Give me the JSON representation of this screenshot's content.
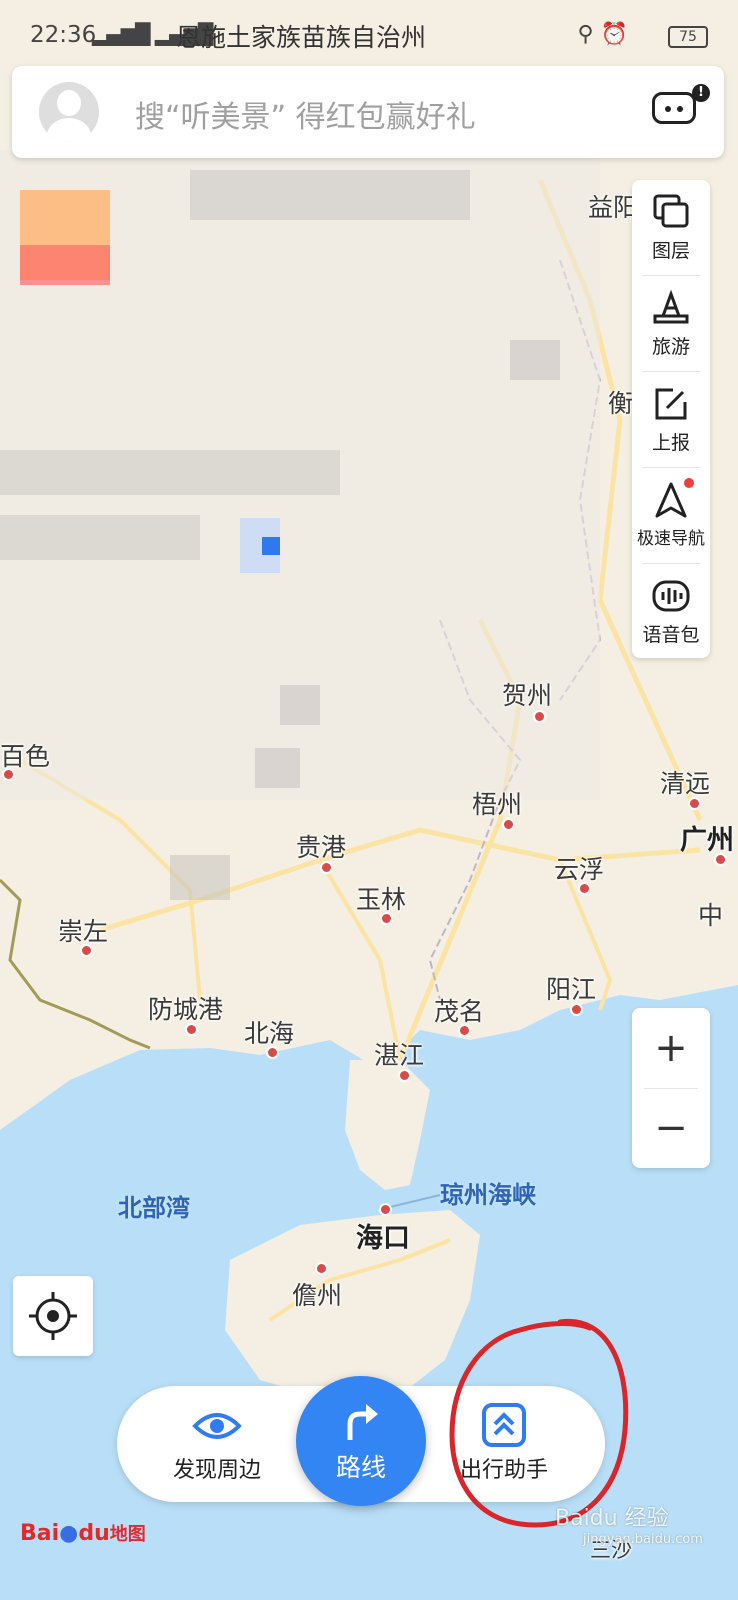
{
  "status_bar": {
    "time": "22:36",
    "signal": "4G 4G",
    "region": "恩施土家族苗族自治州",
    "battery": "75"
  },
  "search": {
    "placeholder": "搜“听美景” 得红包赢好礼"
  },
  "toolbar": {
    "items": [
      {
        "label": "图层",
        "icon": "layers-icon"
      },
      {
        "label": "旅游",
        "icon": "travel-icon"
      },
      {
        "label": "上报",
        "icon": "report-icon"
      },
      {
        "label": "极速导航",
        "icon": "navigation-icon",
        "badge": true
      },
      {
        "label": "语音包",
        "icon": "voice-pack-icon"
      }
    ]
  },
  "map": {
    "places": [
      {
        "name": "益阳"
      },
      {
        "name": "衡"
      },
      {
        "name": "贺州"
      },
      {
        "name": "梧州"
      },
      {
        "name": "清远"
      },
      {
        "name": "广州"
      },
      {
        "name": "百色"
      },
      {
        "name": "贵港"
      },
      {
        "name": "云浮"
      },
      {
        "name": "崇左"
      },
      {
        "name": "玉林"
      },
      {
        "name": "中"
      },
      {
        "name": "防城港"
      },
      {
        "name": "北海"
      },
      {
        "name": "茂名"
      },
      {
        "name": "阳江"
      },
      {
        "name": "湛江"
      },
      {
        "name": "北部湾"
      },
      {
        "name": "琼州海峡"
      },
      {
        "name": "海口"
      },
      {
        "name": "儋州"
      },
      {
        "name": "三沙"
      }
    ]
  },
  "zoom": {
    "in": "+",
    "out": "−"
  },
  "bottom_bar": {
    "discover": "发现周边",
    "route": "路线",
    "assistant": "出行助手"
  },
  "logo": {
    "text_en": "Bai",
    "text_du": "du",
    "text_cn": "地图"
  },
  "watermark": {
    "text": "Baidu 经验",
    "url": "jingyan.baidu.com"
  },
  "colors": {
    "accent": "#3485f4",
    "annotation": "#d9262a",
    "land": "#f4efe2",
    "sea": "#b9dff8"
  }
}
